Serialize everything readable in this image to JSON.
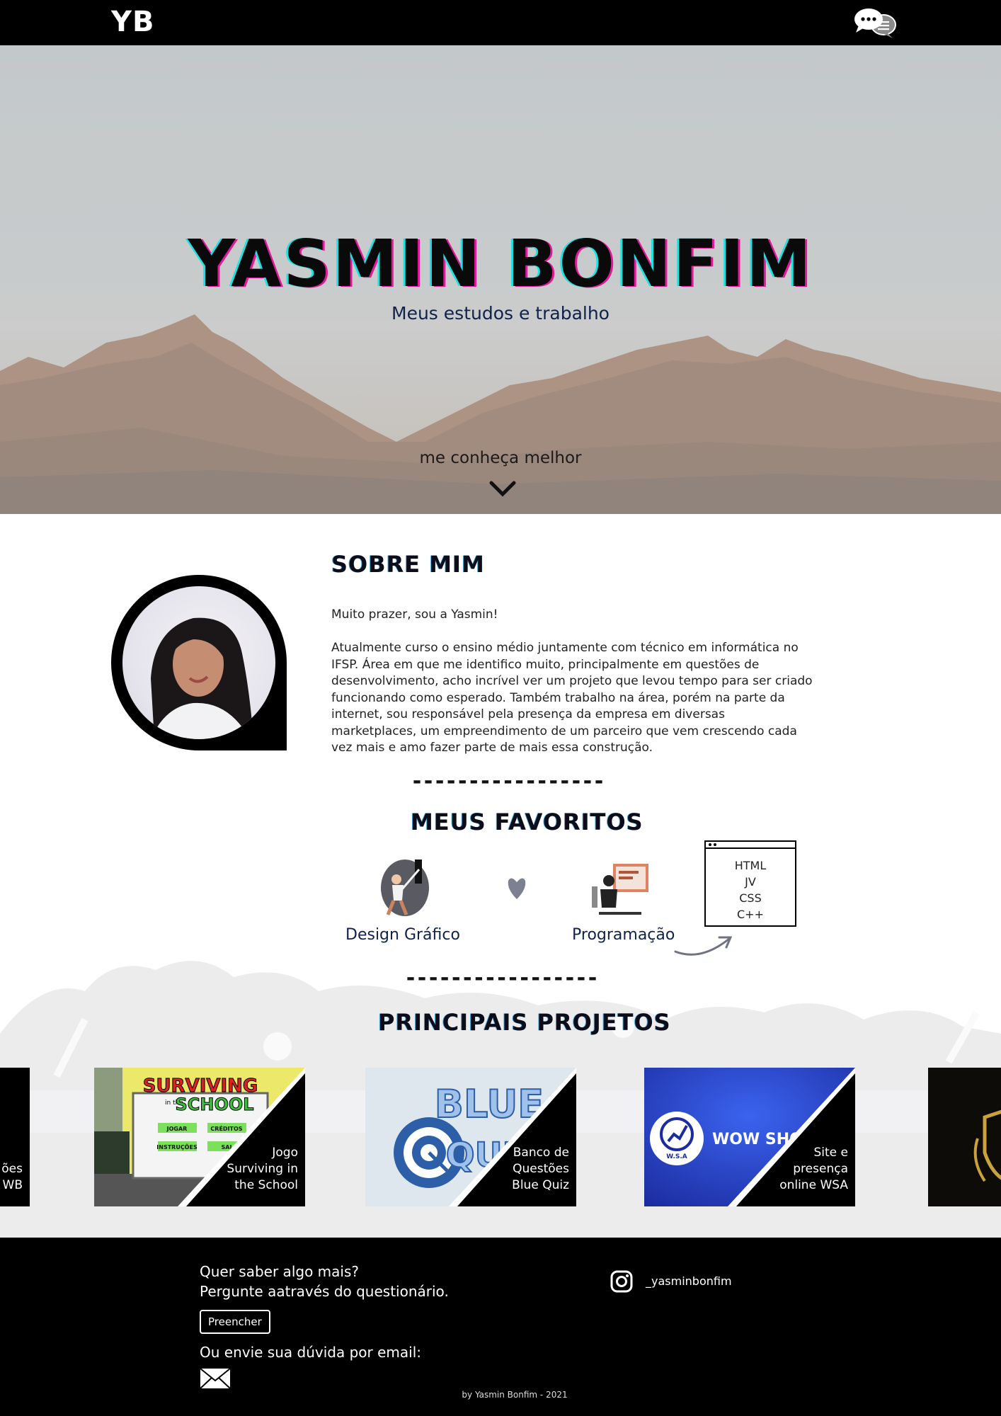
{
  "header": {
    "logo": "YB",
    "chat_icon": "chat-bubbles-icon"
  },
  "hero": {
    "title": "YASMIN BONFIM",
    "subtitle": "Meus estudos e trabalho",
    "more_link": "me conheça melhor",
    "chevron_icon": "chevron-down-icon"
  },
  "about": {
    "title": "SOBRE MIM",
    "greeting": "Muito prazer, sou a Yasmin!",
    "text": " Atualmente curso o ensino médio juntamente com técnico em informática no IFSP. Área em que me identifico muito, principalmente em questões de desenvolvimento, acho incrível ver um projeto que levou tempo para ser criado funcionando como esperado. Também trabalho na área, porém na parte da internet, sou responsável pela presença da empresa em diversas marketplaces, um empreendimento de um parceiro que vem crescendo cada vez mais e amo fazer parte de mais essa construção."
  },
  "divider": "-----------------",
  "favorites": {
    "title": "MEUS FAVORITOS",
    "items": [
      "Design Gráfico",
      "Programação"
    ],
    "languages": [
      "HTML",
      "JV",
      "CSS",
      "C++"
    ],
    "heart_icon": "heart-icon",
    "arrow_icon": "curved-arrow-icon"
  },
  "projects": {
    "title": "PRINCIPAIS PROJETOS",
    "cards": [
      {
        "caption_lines": [
          "ões",
          "WB"
        ]
      },
      {
        "caption_lines": [
          "Jogo",
          "Surviving in",
          "the School"
        ]
      },
      {
        "caption_lines": [
          "Banco de",
          "Questões",
          "Blue Quiz"
        ]
      },
      {
        "caption_lines": [
          "Site e",
          "presença",
          "online WSA"
        ]
      },
      {
        "caption_lines": []
      }
    ],
    "thumb_texts": {
      "surviving_top": "SURVIVING",
      "surviving_mid": "in the",
      "surviving_school": "SCHOOL",
      "btn_play": "JOGAR",
      "btn_credits": "CRÉDITOS",
      "btn_instructions": "INSTRUÇÕES",
      "btn_exit": "SAI",
      "blue": "BLUE",
      "quiz": "QUIZ",
      "wow": "WOW SHOP A",
      "wsa": "W.S.A"
    }
  },
  "footer": {
    "question_line1": "Quer saber algo mais?",
    "question_line2": "Pergunte aatravés do questionário.",
    "fill_button": "Preencher",
    "email_line": "Ou envie sua dúvida por email:",
    "mail_icon": "envelope-icon",
    "instagram_icon": "instagram-icon",
    "instagram_handle": "_yasminbonfim",
    "credit": "by Yasmin Bonfim - 2021"
  }
}
